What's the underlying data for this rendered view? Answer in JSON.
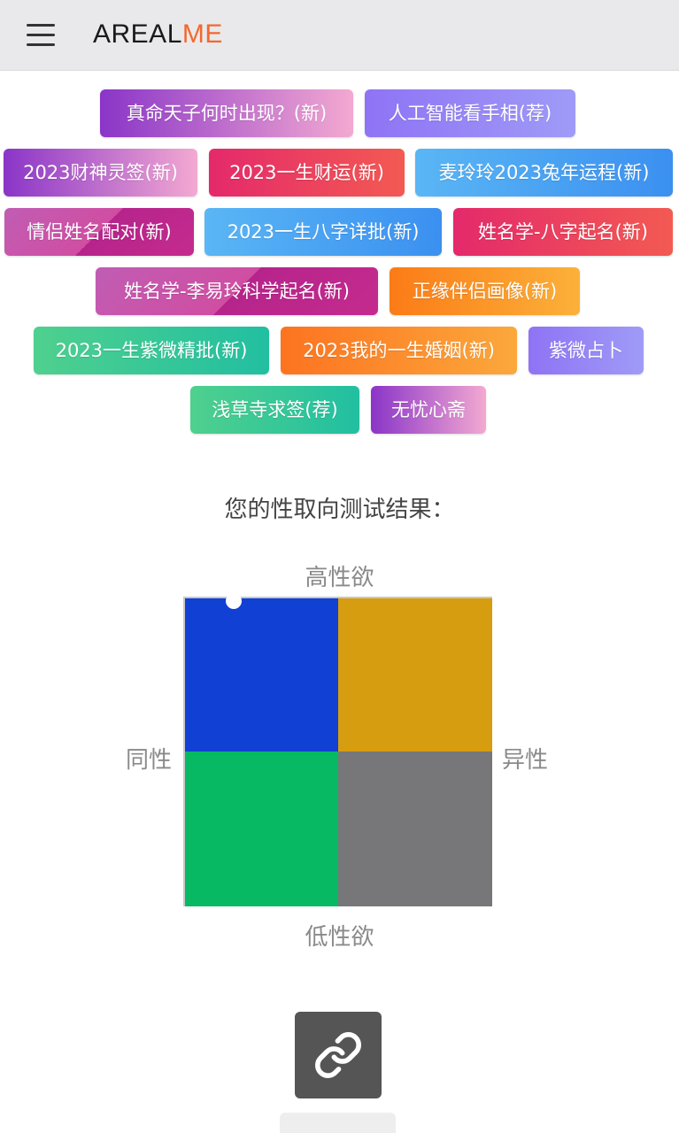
{
  "header": {
    "logo_main": "AREAL",
    "logo_accent": "ME",
    "menu_icon": "hamburger-menu-icon"
  },
  "tags": [
    {
      "label": "真命天子何时出现？(新)",
      "style": "purplepink"
    },
    {
      "label": "人工智能看手相(荐)",
      "style": "lavender"
    },
    {
      "label": "2023财神灵签(新)",
      "style": "purplepink"
    },
    {
      "label": "2023一生财运(新)",
      "style": "red"
    },
    {
      "label": "麦玲玲2023兔年运程(新)",
      "style": "blue"
    },
    {
      "label": "情侣姓名配对(新)",
      "style": "magenta"
    },
    {
      "label": "2023一生八字详批(新)",
      "style": "blue"
    },
    {
      "label": "姓名学-八字起名(新)",
      "style": "red"
    },
    {
      "label": "姓名学-李易玲科学起名(新)",
      "style": "magenta"
    },
    {
      "label": "正缘伴侣画像(新)",
      "style": "orange"
    },
    {
      "label": "2023一生紫微精批(新)",
      "style": "green"
    },
    {
      "label": "2023我的一生婚姻(新)",
      "style": "orange2"
    },
    {
      "label": "紫微占卜",
      "style": "lavender"
    },
    {
      "label": "浅草寺求签(荐)",
      "style": "green"
    },
    {
      "label": "无忧心斋",
      "style": "purplepink"
    }
  ],
  "result": {
    "title": "您的性取向测试结果：",
    "axis_top": "高性欲",
    "axis_bottom": "低性欲",
    "axis_left": "同性",
    "axis_right": "异性",
    "colors": {
      "top_left": "#1040d4",
      "top_right": "#d79d10",
      "bottom_left": "#07b962",
      "bottom_right": "#777779"
    },
    "marker": {
      "x": -0.68,
      "y": 0.98
    }
  },
  "actions": {
    "link_icon": "link-icon"
  }
}
